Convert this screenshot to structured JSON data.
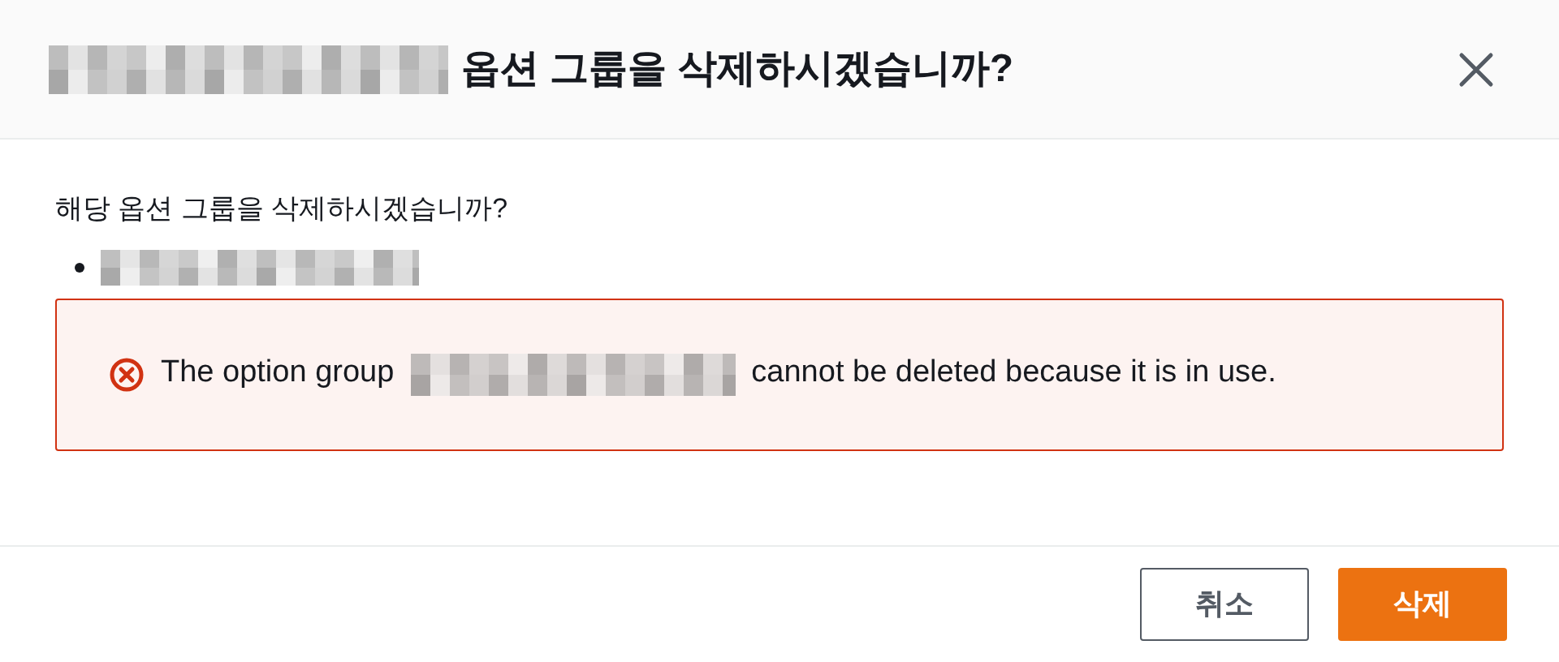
{
  "dialog": {
    "title": "옵션 그룹을 삭제하시겠습니까?",
    "message": "해당 옵션 그룹을 삭제하시겠습니까?",
    "alert": {
      "before": "The option group",
      "after": "cannot be deleted because it is in use."
    },
    "buttons": [
      {
        "kind": "secondary",
        "label": "취소"
      },
      {
        "kind": "primary",
        "label": "삭제"
      }
    ]
  }
}
